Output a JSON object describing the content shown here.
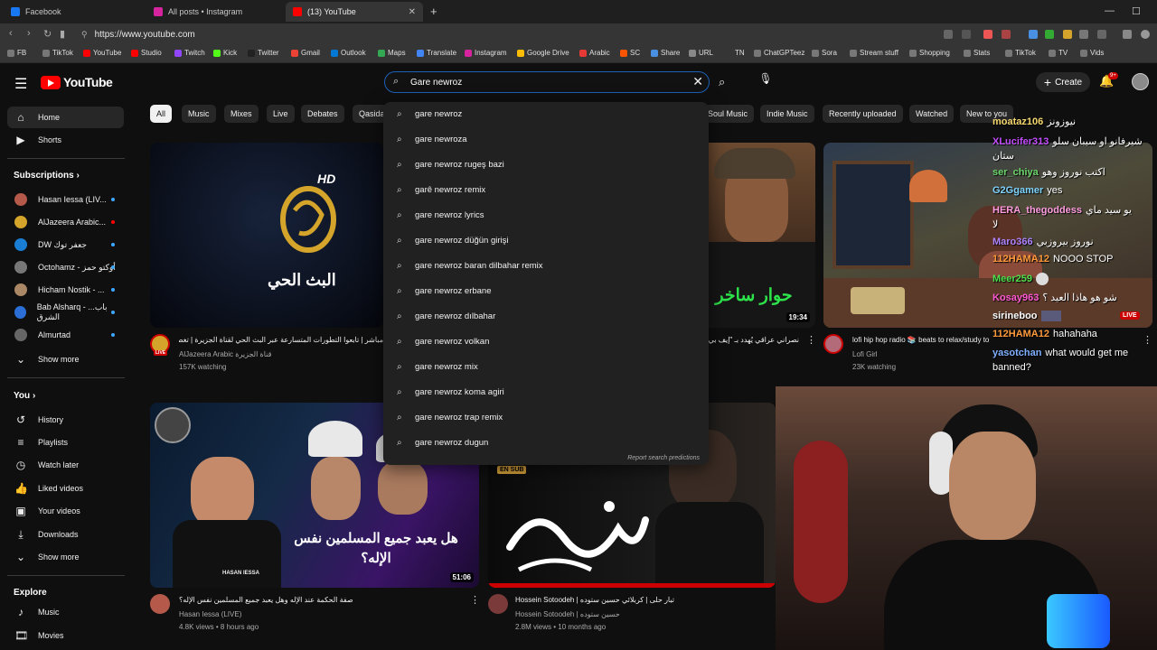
{
  "browser": {
    "tabs": [
      {
        "title": "Facebook",
        "color": "#1877f2"
      },
      {
        "title": "All posts • Instagram",
        "color": "#d6249f"
      },
      {
        "title": "(13) YouTube",
        "color": "#ff0000"
      }
    ],
    "url": "https://www.youtube.com",
    "bookmarks": [
      {
        "label": "FB",
        "color": "#1877f2"
      },
      {
        "label": "TikTok",
        "color": "#000000"
      },
      {
        "label": "YouTube",
        "color": "#ff0000"
      },
      {
        "label": "Studio",
        "color": "#ff0000"
      },
      {
        "label": "Twitch",
        "color": "#9146ff"
      },
      {
        "label": "Kick",
        "color": "#53fc18"
      },
      {
        "label": "Twitter",
        "color": "#222222"
      },
      {
        "label": "Gmail",
        "color": "#ea4335"
      },
      {
        "label": "Outlook",
        "color": "#0078d4"
      },
      {
        "label": "Maps",
        "color": "#34a853"
      },
      {
        "label": "Translate",
        "color": "#4285f4"
      },
      {
        "label": "Instagram",
        "color": "#d6249f"
      },
      {
        "label": "Google Drive",
        "color": "#fbbc04"
      },
      {
        "label": "Arabic",
        "color": "#e53935"
      },
      {
        "label": "SC",
        "color": "#ff5500"
      },
      {
        "label": "Share",
        "color": "#4a90e2"
      },
      {
        "label": "URL",
        "color": "#888888"
      },
      {
        "label": "TN",
        "color": "#555555"
      },
      {
        "label": "ChatGPTeez",
        "color": "#777777"
      },
      {
        "label": "Sora",
        "color": "#777777"
      },
      {
        "label": "Stream stuff",
        "color": "#777777"
      },
      {
        "label": "Shopping",
        "color": "#777777"
      },
      {
        "label": "Stats",
        "color": "#777777"
      },
      {
        "label": "TikTok",
        "color": "#777777"
      },
      {
        "label": "TV",
        "color": "#777777"
      },
      {
        "label": "Vids",
        "color": "#777777"
      }
    ]
  },
  "yt": {
    "logo": "YouTube",
    "search_value": "Gare newroz",
    "create": "Create",
    "notifications": "9+",
    "sidebar": {
      "main": [
        {
          "label": "Home",
          "icon": "home-icon"
        },
        {
          "label": "Shorts",
          "icon": "shorts-icon"
        }
      ],
      "subs_title": "Subscriptions",
      "subs": [
        {
          "label": "Hasan Iessa (LIV...",
          "color": "#b55a4a"
        },
        {
          "label": "AlJazeera Arabic...",
          "color": "#d4a52a"
        },
        {
          "label": "DW جعفر توك",
          "color": "#1a7fd4"
        },
        {
          "label": "Octohamz - أوكتو حمز",
          "color": "#777777"
        },
        {
          "label": "Hicham Nostik - ...",
          "color": "#aa8866"
        },
        {
          "label": "Bab Alsharq - ...باب الشرق",
          "color": "#2b6fd6"
        },
        {
          "label": "Almurtad",
          "color": "#666666"
        }
      ],
      "show_more": "Show more",
      "you_title": "You",
      "you": [
        {
          "label": "History",
          "icon": "history-icon"
        },
        {
          "label": "Playlists",
          "icon": "playlists-icon"
        },
        {
          "label": "Watch later",
          "icon": "watch-later-icon"
        },
        {
          "label": "Liked videos",
          "icon": "liked-icon"
        },
        {
          "label": "Your videos",
          "icon": "your-videos-icon"
        },
        {
          "label": "Downloads",
          "icon": "downloads-icon"
        }
      ],
      "show_more2": "Show more",
      "explore_title": "Explore",
      "explore": [
        {
          "label": "Music",
          "icon": "music-icon"
        },
        {
          "label": "Movies",
          "icon": "movies-icon"
        }
      ]
    },
    "chips": [
      "All",
      "Music",
      "Mixes",
      "Live",
      "Debates",
      "Qasida",
      "Soul Music",
      "Indie Music",
      "Recently uploaded",
      "Watched",
      "New to you"
    ],
    "suggestions": [
      "gare newroz",
      "gare newroza",
      "gare newroz rugeş bazi",
      "garê newroz remix",
      "gare newroz lyrics",
      "gare newroz düğün girişi",
      "gare newroz baran dilbahar remix",
      "gare newroz erbane",
      "gare newroz dılbahar",
      "gare newroz volkan",
      "gare newroz mix",
      "gare newroz koma agiri",
      "gare newroz trap remix",
      "gare newroz dugun"
    ],
    "report": "Report search predictions",
    "videos": [
      {
        "title": "مباشر | تابعوا التطورات المتسارعة عبر البث الحي لقناة الجزيرة | تغطية مباشرة",
        "channel": "AlJazeera Arabic قناة الجزيرة",
        "meta": "157K watching",
        "thumb_text": "البث الحي",
        "hd": "HD",
        "live": "LIVE"
      },
      {
        "title": "نصراني عراقي يُهدد بـ \"إيف بي...",
        "duration": "19:34",
        "thumb_text": "حوار ساخر"
      },
      {
        "title": "lofi hip hop radio 📚 beats to relax/study to",
        "channel": "Lofi Girl",
        "meta": "23K watching",
        "live": "LIVE"
      },
      {
        "title": "صفة الحكمة عند الإله وهل يعبد جميع المسلمين نفس الإله؟",
        "channel": "Hasan Iessa (LIVE)",
        "meta": "4.8K views • 8 hours ago",
        "duration": "51:06",
        "thumb_text": "هل يعبد جميع المسلمين نفس الإله؟",
        "brand": "HASAN IESSA"
      },
      {
        "title": "Hossein Sotoodeh | تبار حلى | كربلائي حسين ستوده",
        "channel": "Hossein Sotoodeh | حسين ستوده",
        "meta": "2.8M views • 10 months ago",
        "sub_badge": "EN SUB"
      }
    ]
  },
  "chat": [
    {
      "user": "moataz106",
      "msg": "نيوزونز",
      "color": "#f5d76e"
    },
    {
      "user": "XLucifer313",
      "msg": "شيرفانو او سيبان سلو",
      "color": "#c44dff"
    },
    {
      "user": "",
      "msg": "ستان",
      "color": "#ffffff"
    },
    {
      "user": "ser_chiya",
      "msg": "اكتب نوروز وهو",
      "color": "#6bd66b"
    },
    {
      "user": "G2Ggamer",
      "msg": "yes",
      "color": "#7fd4ff"
    },
    {
      "user": "HERA_thegoddess",
      "msg": "يو سيد ماي",
      "color": "#ff9de0"
    },
    {
      "user": "",
      "msg": "لا",
      "color": "#ffffff"
    },
    {
      "user": "Maro366",
      "msg": "نوروز بيروزبي",
      "color": "#b084ff"
    },
    {
      "user": "112HAMA12",
      "msg": "NOOO STOP",
      "color": "#ff9a3c"
    },
    {
      "user": "Meer259",
      "msg": "",
      "color": "#4ee04e"
    },
    {
      "user": "Kosay963",
      "msg": "شو هو هاذا العيد ؟",
      "color": "#ff5ad2"
    },
    {
      "user": "sirineboo",
      "msg": "",
      "color": "#ffffff"
    },
    {
      "user": "112HAMA12",
      "msg": "hahahaha",
      "color": "#ff9a3c"
    },
    {
      "user": "yasotchan",
      "msg": "what would get me",
      "color": "#7fb0ff"
    },
    {
      "user": "",
      "msg": "banned?",
      "color": "#ffffff"
    }
  ]
}
